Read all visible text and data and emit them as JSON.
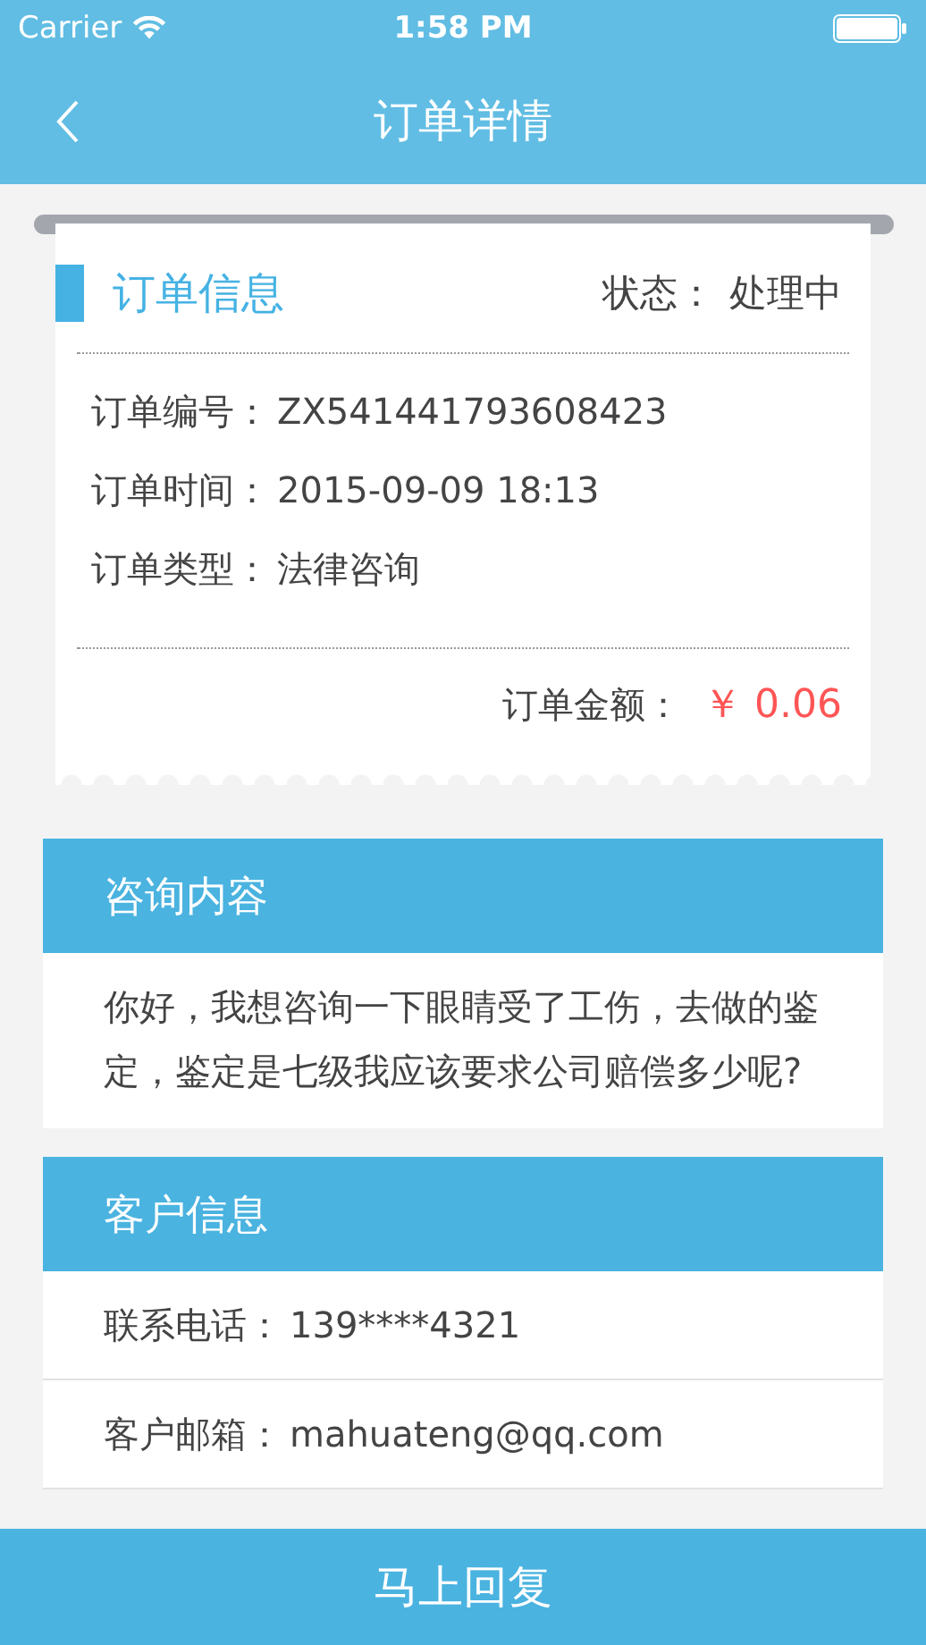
{
  "status_bar": {
    "carrier": "Carrier",
    "time": "1:58 PM"
  },
  "nav": {
    "title": "订单详情"
  },
  "order_card": {
    "title": "订单信息",
    "status_label": "状态：",
    "status_value": "处理中",
    "fields": [
      {
        "label": "订单编号：",
        "value": "ZX541441793608423"
      },
      {
        "label": "订单时间：",
        "value": "2015-09-09 18:13"
      },
      {
        "label": "订单类型：",
        "value": "法律咨询"
      }
    ],
    "amount_label": "订单金额：",
    "amount_value": "￥ 0.06"
  },
  "consult": {
    "title": "咨询内容",
    "text": "你好，我想咨询一下眼睛受了工伤，去做的鉴定，鉴定是七级我应该要求公司赔偿多少呢?"
  },
  "customer": {
    "title": "客户信息",
    "fields": [
      {
        "label": "联系电话：",
        "value": "139****4321"
      },
      {
        "label": "客户邮箱：",
        "value": "mahuateng@qq.com"
      }
    ]
  },
  "reply_button": {
    "label": "马上回复"
  }
}
